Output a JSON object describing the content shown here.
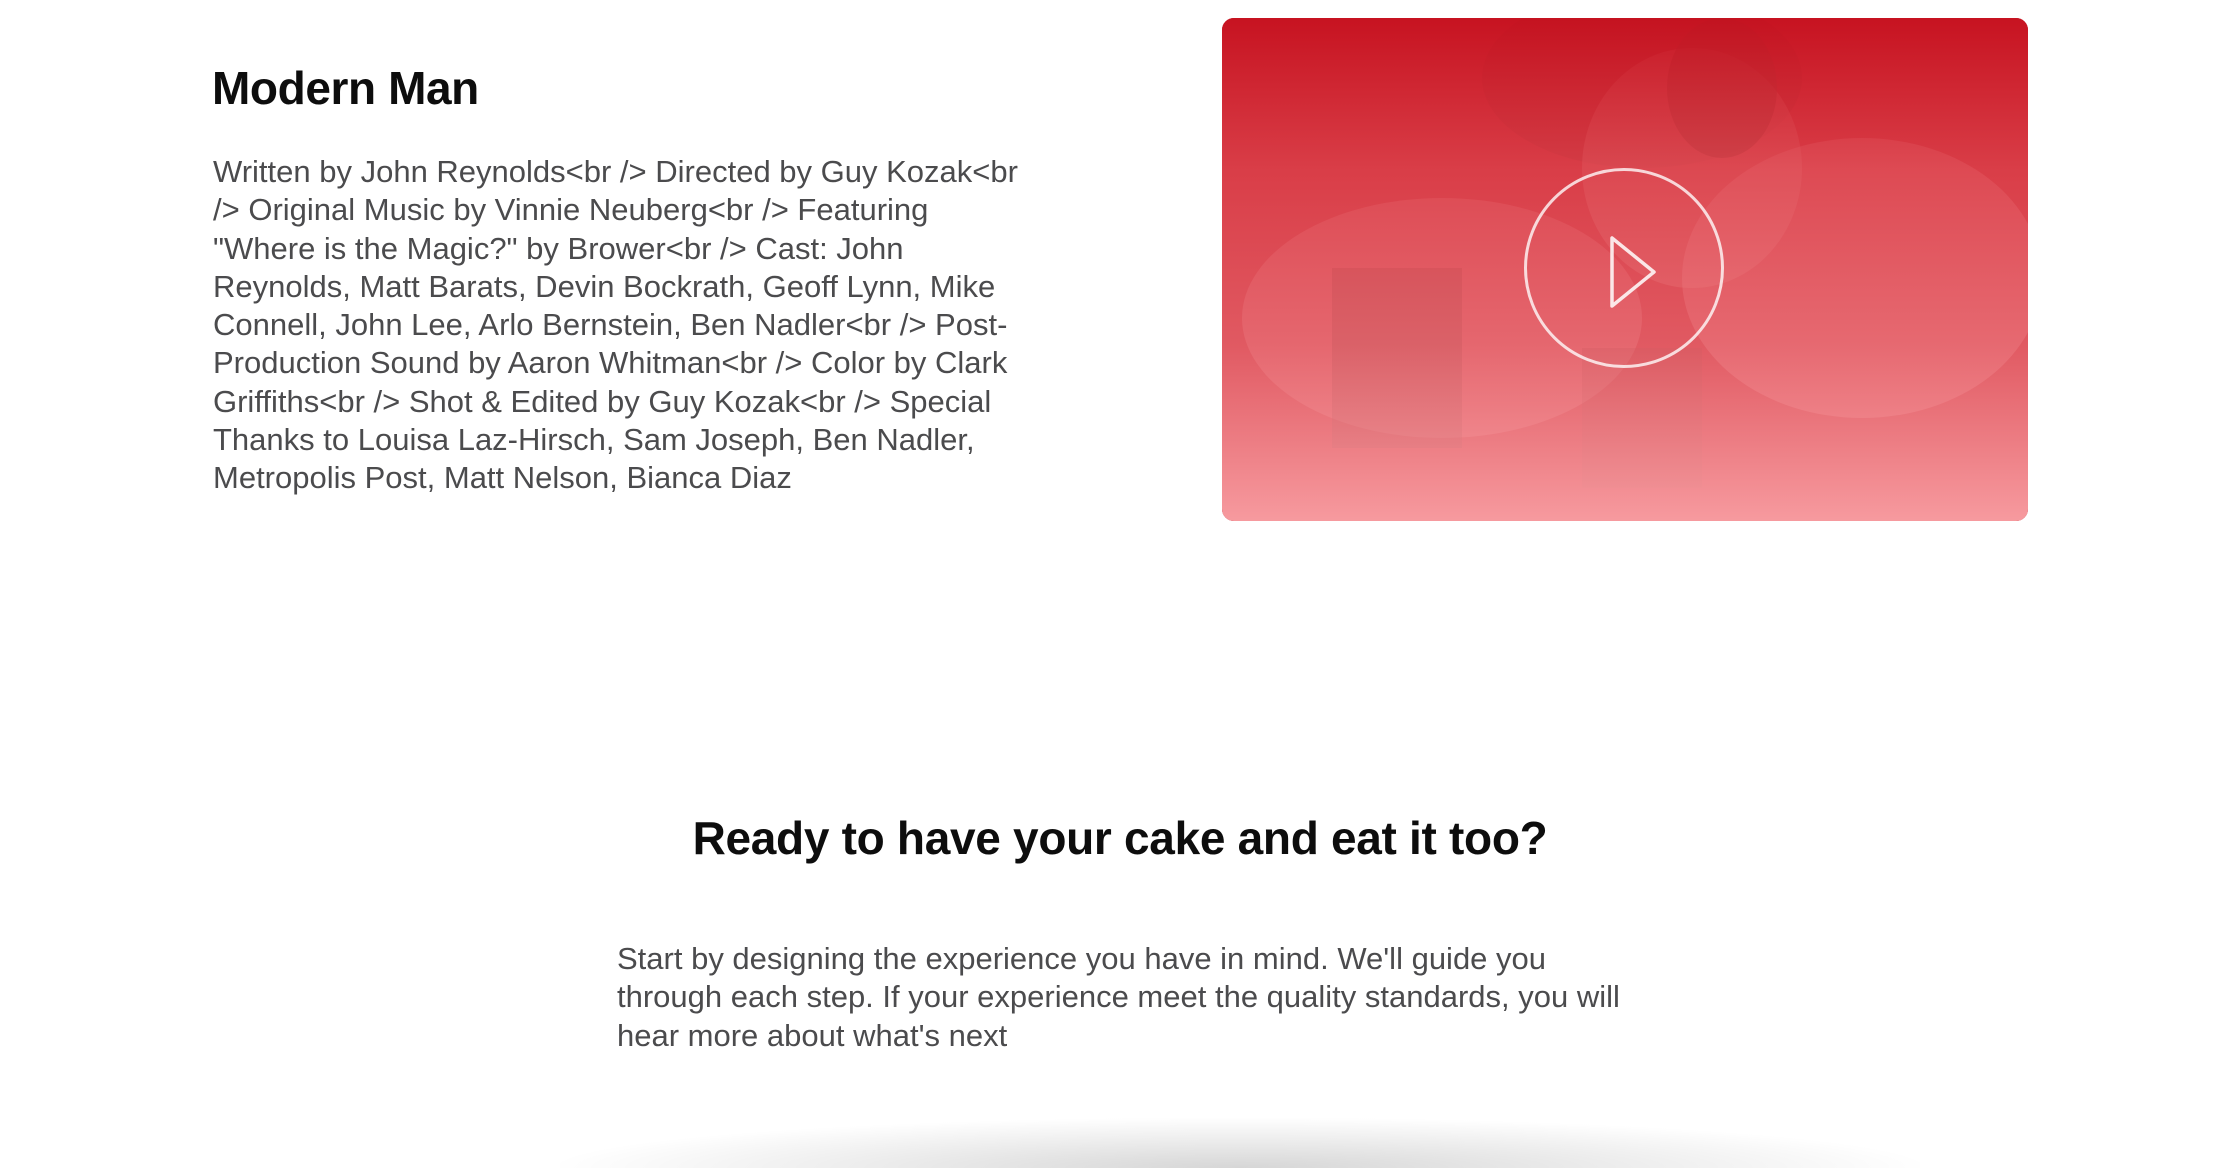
{
  "film": {
    "title": "Modern Man",
    "credits": "Written by John Reynolds<br /> Directed by Guy Kozak<br /> Original Music by Vinnie Neuberg<br /> Featuring \"Where is the Magic?\" by Brower<br /> Cast: John Reynolds, Matt Barats, Devin Bockrath, Geoff Lynn, Mike Connell, John Lee, Arlo Bernstein, Ben Nadler<br /> Post-Production Sound by Aaron Whitman<br /> Color by Clark Griffiths<br /> Shot & Edited by Guy Kozak<br /> Special Thanks to Louisa Laz-Hirsch, Sam Joseph, Ben Nadler, Metropolis Post, Matt Nelson, Bianca Diaz"
  },
  "video": {
    "play_icon": "play-icon",
    "overlay_color_top": "#c8101e",
    "overlay_color_bottom": "#ffa8ac"
  },
  "cta": {
    "title": "Ready to have your cake and eat it too?",
    "body": "Start by designing the experience you have in mind. We'll guide you through each step. If your experience meet the quality standards, you will hear more about what's next"
  }
}
